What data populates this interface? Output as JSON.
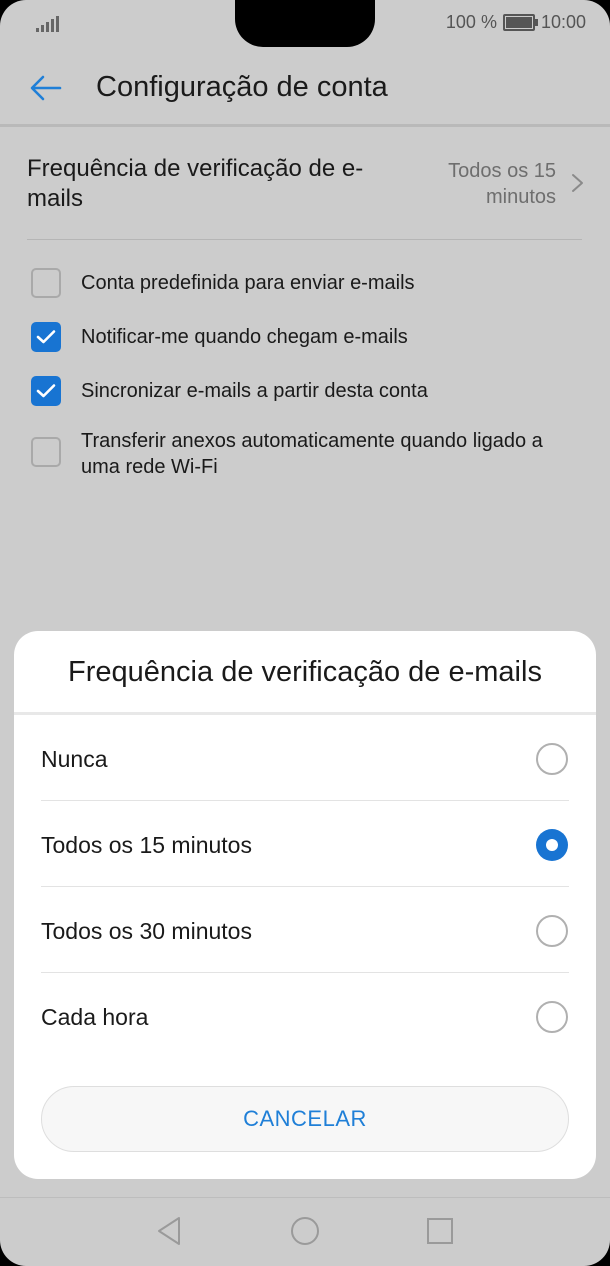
{
  "status_bar": {
    "battery_percent": "100 %",
    "time": "10:00"
  },
  "header": {
    "title": "Configuração de conta"
  },
  "check_frequency": {
    "label": "Frequência de verificação de e-mails",
    "value": "Todos os 15 minutos"
  },
  "options": [
    {
      "label": "Conta predefinida para enviar e-mails",
      "checked": false
    },
    {
      "label": "Notificar-me quando chegam e-mails",
      "checked": true
    },
    {
      "label": "Sincronizar e-mails a partir desta conta",
      "checked": true
    },
    {
      "label": "Transferir anexos automaticamente quando ligado a uma rede Wi-Fi",
      "checked": false
    }
  ],
  "dialog": {
    "title": "Frequência de verificação de e-mails",
    "choices": [
      {
        "label": "Nunca",
        "selected": false
      },
      {
        "label": "Todos os 15 minutos",
        "selected": true
      },
      {
        "label": "Todos os 30 minutos",
        "selected": false
      },
      {
        "label": "Cada hora",
        "selected": false
      }
    ],
    "cancel_label": "CANCELAR"
  },
  "colors": {
    "accent": "#1874d2",
    "dim_background": "#cccccc",
    "dialog_background": "#ffffff"
  },
  "icons": {
    "back": "arrow-left-icon",
    "chevron": "chevron-right-icon",
    "nav_back": "triangle-back-icon",
    "nav_home": "circle-home-icon",
    "nav_recents": "square-recents-icon"
  }
}
